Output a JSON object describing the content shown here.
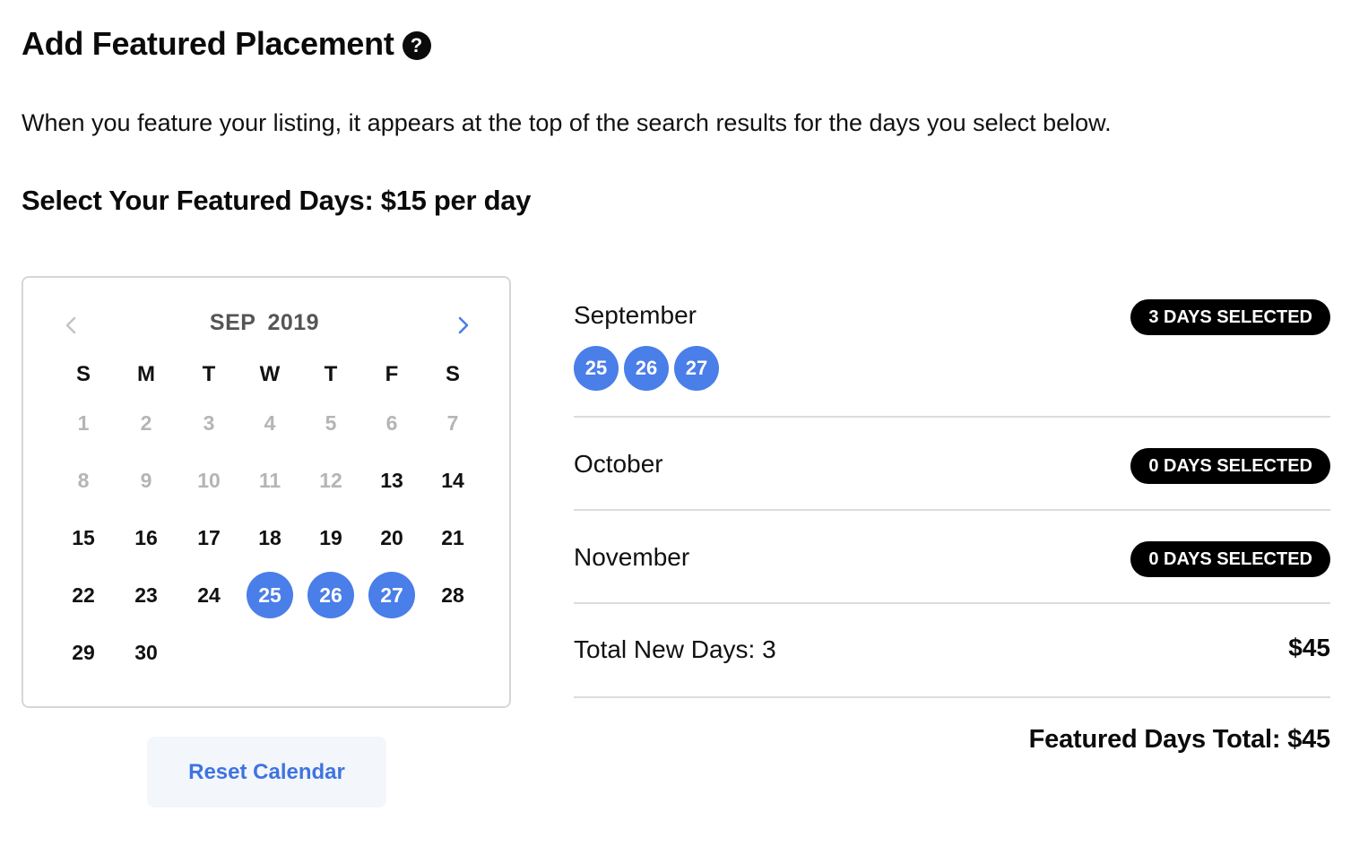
{
  "page": {
    "title": "Add Featured Placement",
    "help_icon": "?",
    "intro": "When you feature your listing, it appears at the top of the search results for the days you select below.",
    "select_heading": "Select Your Featured Days: $15 per day"
  },
  "calendar": {
    "month_label": "SEP 2019",
    "prev_icon": "chevron-left-icon",
    "next_icon": "chevron-right-icon",
    "weekdays": [
      "S",
      "M",
      "T",
      "W",
      "T",
      "F",
      "S"
    ],
    "disabled_days": [
      1,
      2,
      3,
      4,
      5,
      6,
      7,
      8,
      9,
      10,
      11,
      12
    ],
    "selected_days": [
      25,
      26,
      27
    ],
    "first_weekday": 0,
    "days_in_month": 30,
    "accent_color": "#4a7ee8"
  },
  "reset_button": {
    "label": "Reset Calendar"
  },
  "summary": {
    "months": [
      {
        "name": "September",
        "badge": "3 DAYS SELECTED",
        "days": [
          "25",
          "26",
          "27"
        ]
      },
      {
        "name": "October",
        "badge": "0 DAYS SELECTED",
        "days": []
      },
      {
        "name": "November",
        "badge": "0 DAYS SELECTED",
        "days": []
      }
    ],
    "total_label": "Total New Days: 3",
    "total_amount": "$45",
    "grand_total": "Featured Days Total: $45"
  }
}
